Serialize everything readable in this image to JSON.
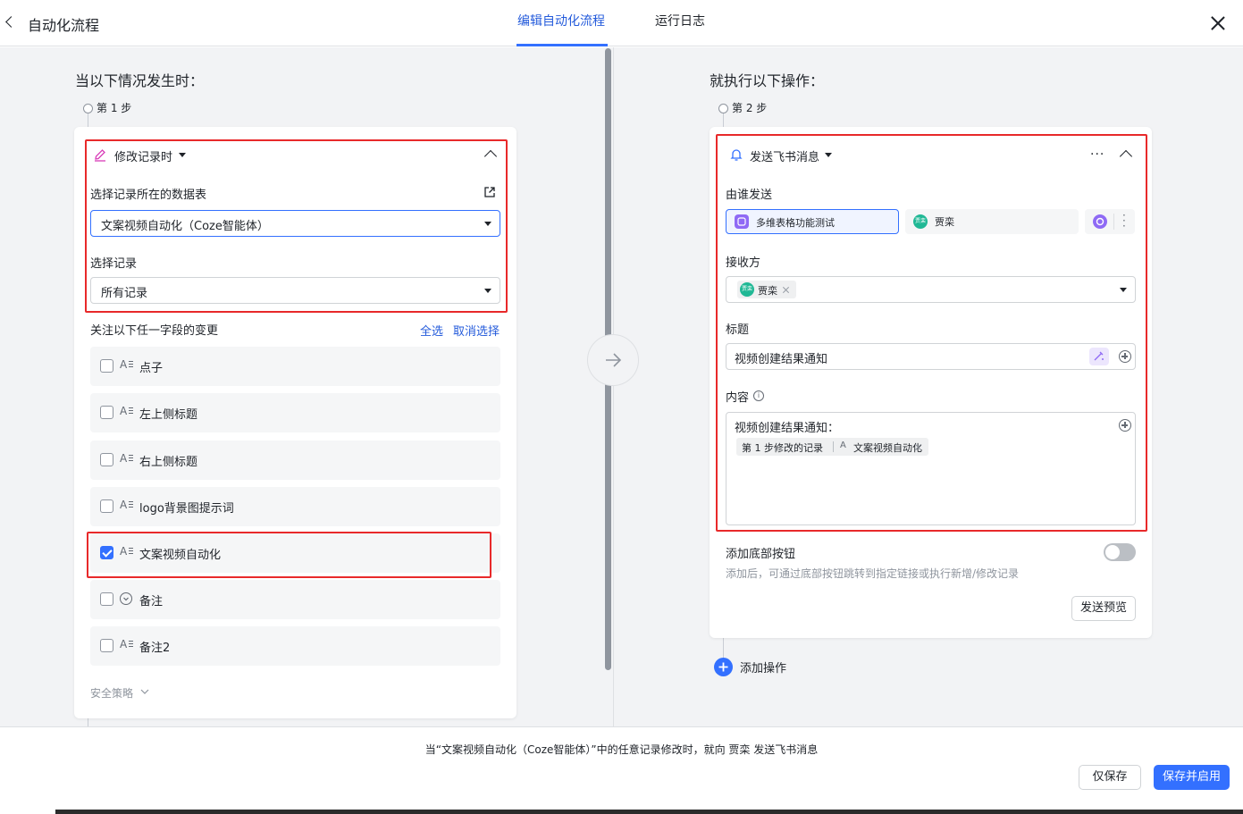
{
  "header": {
    "title": "自动化流程",
    "tabs": [
      {
        "label": "编辑自动化流程",
        "active": true
      },
      {
        "label": "运行日志",
        "active": false
      }
    ]
  },
  "trigger": {
    "section_title": "当以下情况发生时：",
    "step_label": "第 1 步",
    "type_label": "修改记录时",
    "table_label": "选择记录所在的数据表",
    "table_value": "文案视频自动化（Coze智能体）",
    "record_label": "选择记录",
    "record_value": "所有记录",
    "watch_label": "关注以下任一字段的变更",
    "select_all": "全选",
    "deselect": "取消选择",
    "fields": [
      {
        "name": "点子",
        "type_icon": "text-field-icon",
        "checked": false
      },
      {
        "name": "左上侧标题",
        "type_icon": "text-field-icon",
        "checked": false
      },
      {
        "name": "右上侧标题",
        "type_icon": "text-field-icon",
        "checked": false
      },
      {
        "name": "logo背景图提示词",
        "type_icon": "text-field-icon",
        "checked": false
      },
      {
        "name": "文案视频自动化",
        "type_icon": "text-field-icon",
        "checked": true
      },
      {
        "name": "备注",
        "type_icon": "single-select-field-icon",
        "checked": false
      },
      {
        "name": "备注2",
        "type_icon": "text-field-icon",
        "checked": false
      }
    ],
    "security_label": "安全策略"
  },
  "action": {
    "section_title": "就执行以下操作：",
    "step_label": "第 2 步",
    "type_label": "发送飞书消息",
    "sender_label": "由谁发送",
    "sender_app": "多维表格功能测试",
    "sender_user": "贾栾",
    "avatar_text": "贾栾",
    "receiver_label": "接收方",
    "receiver_tag": "贾栾",
    "title_label": "标题",
    "title_value": "视频创建结果通知",
    "content_label": "内容",
    "content_text": "视频创建结果通知：",
    "content_tag_step": "第 1 步修改的记录",
    "content_tag_field": "文案视频自动化",
    "footer_button_label": "添加底部按钮",
    "footer_button_desc": "添加后，可通过底部按钮跳转到指定链接或执行新增/修改记录",
    "preview_button": "发送预览",
    "add_action": "添加操作"
  },
  "footer": {
    "summary": "当“文案视频自动化（Coze智能体）”中的任意记录修改时，就向 贾栾 发送飞书消息",
    "save_label": "仅保存",
    "save_enable_label": "保存并启用"
  },
  "colors": {
    "accent": "#3370ff",
    "highlight_box": "#e8292a",
    "app_icon": "#8f6af5",
    "avatar": "#20b895"
  }
}
